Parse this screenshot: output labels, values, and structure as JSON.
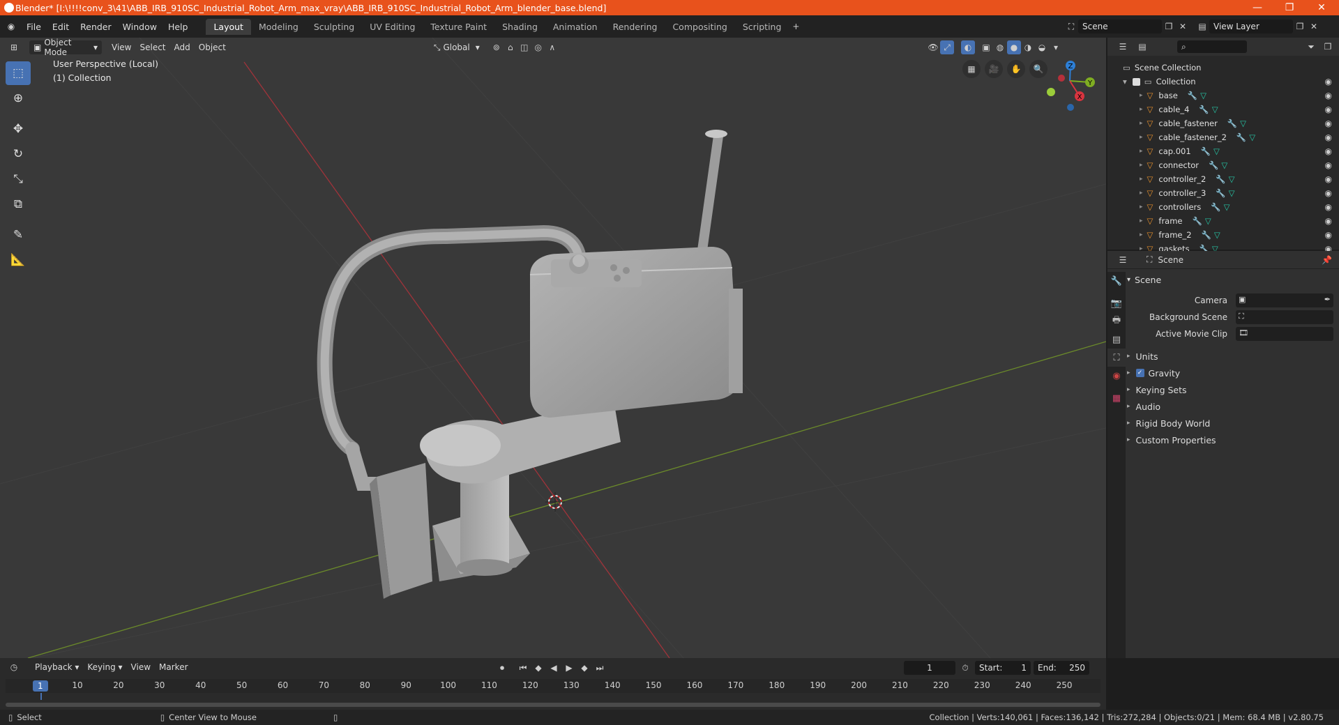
{
  "window": {
    "title": "Blender* [I:\\!!!!conv_3\\41\\ABB_IRB_910SC_Industrial_Robot_Arm_max_vray\\ABB_IRB_910SC_Industrial_Robot_Arm_blender_base.blend]",
    "minimize": "—",
    "maximize": "❐",
    "close": "✕"
  },
  "menu": [
    "File",
    "Edit",
    "Render",
    "Window",
    "Help"
  ],
  "workspaces": [
    "Layout",
    "Modeling",
    "Sculpting",
    "UV Editing",
    "Texture Paint",
    "Shading",
    "Animation",
    "Rendering",
    "Compositing",
    "Scripting"
  ],
  "active_workspace": "Layout",
  "scene_name": "Scene",
  "view_layer": "View Layer",
  "viewport_header": {
    "mode": "Object Mode",
    "menus": [
      "View",
      "Select",
      "Add",
      "Object"
    ],
    "orientation": "Global"
  },
  "viewport": {
    "perspective": "User Perspective (Local)",
    "collection": "(1) Collection",
    "gizmo_axes": [
      "Z",
      "Y",
      "X"
    ]
  },
  "outliner": {
    "root": "Scene Collection",
    "collection": "Collection",
    "items": [
      "base",
      "cable_4",
      "cable_fastener",
      "cable_fastener_2",
      "cap.001",
      "connector",
      "controller_2",
      "controller_3",
      "controllers",
      "frame",
      "frame_2",
      "gaskets"
    ]
  },
  "properties": {
    "header": "Scene",
    "section": "Scene",
    "fields": [
      {
        "label": "Camera"
      },
      {
        "label": "Background Scene"
      },
      {
        "label": "Active Movie Clip"
      }
    ],
    "panels": [
      "Units",
      "Gravity",
      "Keying Sets",
      "Audio",
      "Rigid Body World",
      "Custom Properties"
    ],
    "gravity_checked": true
  },
  "timeline": {
    "menus": [
      "Playback",
      "Keying",
      "View",
      "Marker"
    ],
    "current_frame": "1",
    "start_label": "Start:",
    "start": "1",
    "end_label": "End:",
    "end": "250",
    "ticks": [
      "1",
      "10",
      "20",
      "30",
      "40",
      "50",
      "60",
      "70",
      "80",
      "90",
      "100",
      "110",
      "120",
      "130",
      "140",
      "150",
      "160",
      "170",
      "180",
      "190",
      "200",
      "210",
      "220",
      "230",
      "240",
      "250"
    ]
  },
  "statusbar": {
    "select": "Select",
    "center_view": "Center View to Mouse",
    "stats": "Collection | Verts:140,061 | Faces:136,142 | Tris:272,284 | Objects:0/21 | Mem: 68.4 MB | v2.80.75"
  },
  "colors": {
    "titlebar": "#e8521c",
    "accent": "#4772b3",
    "x_axis": "#d9343f",
    "y_axis": "#7fad22",
    "z_axis": "#2d7fd6"
  }
}
